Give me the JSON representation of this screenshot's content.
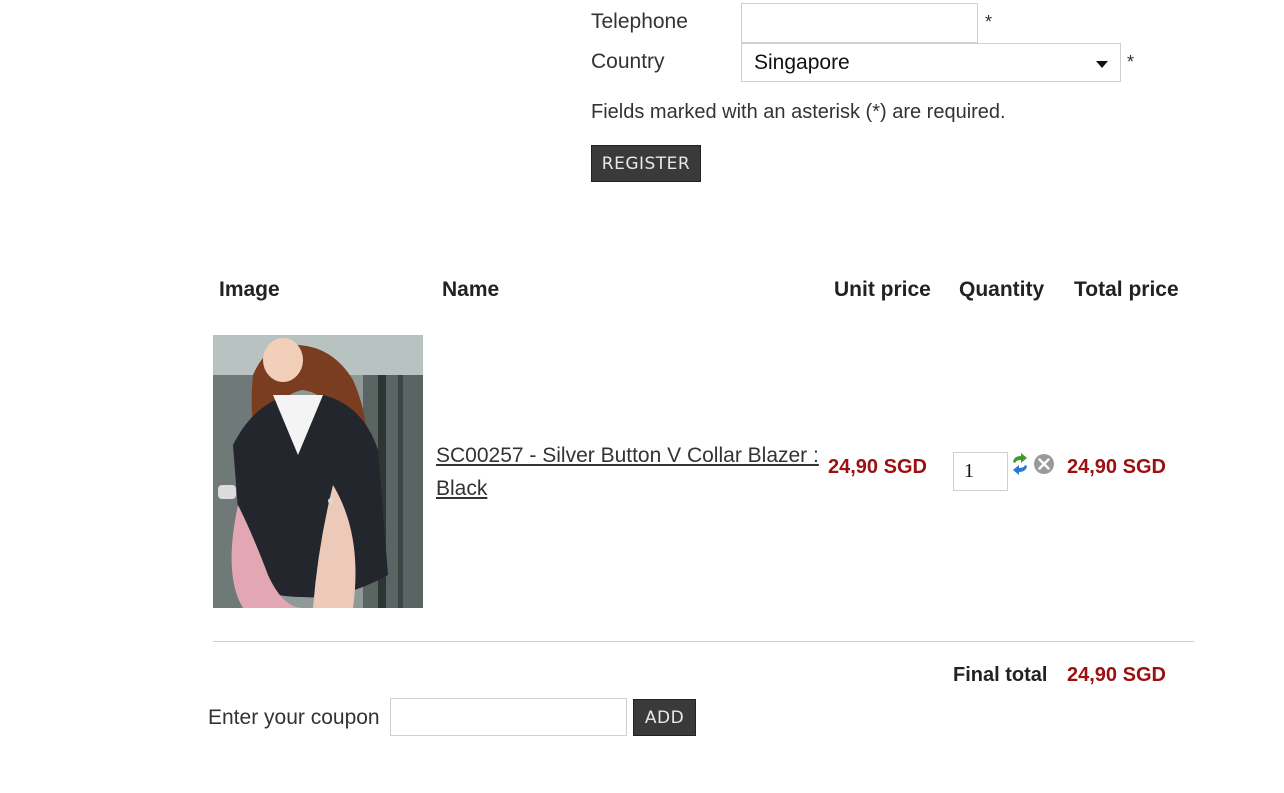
{
  "registration": {
    "telephone_label": "Telephone",
    "telephone_value": "",
    "country_label": "Country",
    "country_value": "Singapore",
    "required_marker": "*",
    "required_note": "Fields marked with an asterisk (*) are required.",
    "register_label": "REGISTER"
  },
  "cart": {
    "headers": {
      "image": "Image",
      "name": "Name",
      "unit_price": "Unit price",
      "quantity": "Quantity",
      "total_price": "Total price"
    },
    "item": {
      "name_line1": "SC00257 - Silver Button V Collar Blazer :",
      "name_line2": "Black",
      "unit_price": "24,90 SGD",
      "quantity": "1",
      "total_price": "24,90 SGD"
    },
    "final_total_label": "Final total",
    "final_total_value": "24,90 SGD"
  },
  "coupon": {
    "label": "Enter your coupon",
    "value": "",
    "add_label": "ADD"
  },
  "colors": {
    "price": "#9b1010",
    "button_bg": "#3a3a3a"
  },
  "icons": {
    "update": "refresh-icon",
    "remove": "remove-icon",
    "dropdown": "chevron-down-icon"
  }
}
